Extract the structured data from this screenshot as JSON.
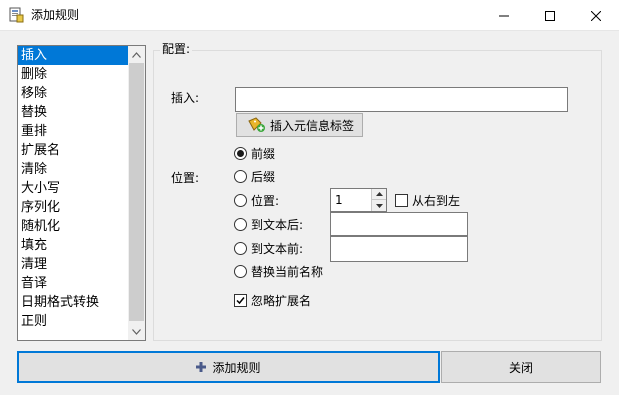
{
  "window": {
    "title": "添加规则",
    "minimize_icon": "minimize-icon",
    "maximize_icon": "maximize-icon",
    "close_icon": "close-icon"
  },
  "rules_list": {
    "items": [
      "插入",
      "删除",
      "移除",
      "替换",
      "重排",
      "扩展名",
      "清除",
      "大小写",
      "序列化",
      "随机化",
      "填充",
      "清理",
      "音译",
      "日期格式转换",
      "正则"
    ],
    "selected": "插入"
  },
  "config": {
    "group_title": "配置:",
    "insert_label": "插入:",
    "insert_value": "",
    "meta_button": "插入元信息标签",
    "position_label": "位置:",
    "options": {
      "prefix": "前缀",
      "suffix": "后缀",
      "position": "位置:",
      "after_text": "到文本后:",
      "before_text": "到文本前:",
      "replace_name": "替换当前名称"
    },
    "selected_option": "前缀",
    "position_value": "1",
    "after_text_value": "",
    "before_text_value": "",
    "right_to_left": "从右到左",
    "right_to_left_checked": false,
    "ignore_ext": "忽略扩展名",
    "ignore_ext_checked": true
  },
  "buttons": {
    "add": "添加规则",
    "close": "关闭"
  },
  "colors": {
    "selection": "#0078d7",
    "button_face": "#e1e1e1",
    "window_bg": "#f0f0f0"
  }
}
